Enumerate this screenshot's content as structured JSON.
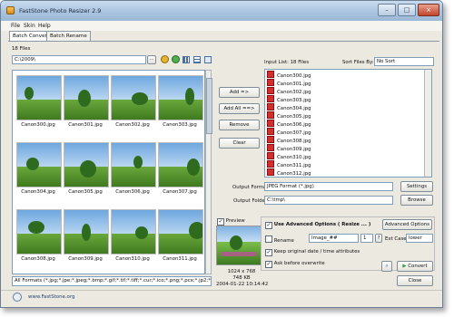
{
  "window": {
    "title": "FastStone Photo Resizer 2.9",
    "controls": {
      "minimize": "–",
      "maximize": "□",
      "close": "×"
    }
  },
  "menu": [
    "File",
    "Skin",
    "Help"
  ],
  "tabs": [
    "Batch Convert",
    "Batch Rename"
  ],
  "left": {
    "files_count": "18 Files",
    "path": "C:\\2009\\",
    "browse_button": "...",
    "thumbnails": [
      "Canon300.jpg",
      "Canon301.jpg",
      "Canon302.jpg",
      "Canon303.jpg",
      "Canon304.jpg",
      "Canon305.jpg",
      "Canon306.jpg",
      "Canon307.jpg",
      "Canon308.jpg",
      "Canon309.jpg",
      "Canon310.jpg",
      "Canon311.jpg"
    ],
    "filter": "All Formats (*.jpg;*.jpe;*.jpeg;*.bmp;*.gif;*.tif;*.tiff;*.cur;*.ico;*.png;*.pcx;*.jp2;*.j2"
  },
  "actions": {
    "add": "Add =>",
    "add_all": "Add All ==>",
    "remove": "Remove",
    "clear": "Clear"
  },
  "right": {
    "input_list_label": "Input List:  18 Files",
    "sort_label": "Sort Files By:",
    "sort_value": "No Sort",
    "input_files": [
      "Canon300.jpg",
      "Canon301.jpg",
      "Canon302.jpg",
      "Canon303.jpg",
      "Canon304.jpg",
      "Canon305.jpg",
      "Canon306.jpg",
      "Canon307.jpg",
      "Canon308.jpg",
      "Canon309.jpg",
      "Canon310.jpg",
      "Canon311.jpg",
      "Canon312.jpg"
    ],
    "output_format_label": "Output Format:",
    "output_format_value": "JPEG Format (*.jpg)",
    "settings_button": "Settings",
    "output_folder_label": "Output Folder:",
    "output_folder_value": "C:\\tmp\\",
    "browse_folder_button": "Browse"
  },
  "preview": {
    "label": "Preview",
    "dimensions": "1024 x 768",
    "size": "748 KB",
    "date": "2004-01-22 10:14:42"
  },
  "advanced": {
    "use_advanced_label": "Use Advanced Options ( Resize ... )",
    "advanced_button": "Advanced Options",
    "rename_label": "Rename",
    "rename_pattern": "Image_##",
    "rename_start": "1",
    "help_button": "?",
    "ext_case_label": "Ext Case",
    "ext_case_value": "lower",
    "keep_date_label": "Keep original date / time attributes",
    "ask_overwrite_label": "Ask before overwrite"
  },
  "buttons": {
    "convert": "Convert",
    "close": "Close"
  },
  "status": {
    "url": "www.FastStone.org"
  },
  "colors": {
    "accent": "#3a6ea5",
    "file_icon": "#d32f2f",
    "convert_arrow": "#2e9b3a"
  }
}
